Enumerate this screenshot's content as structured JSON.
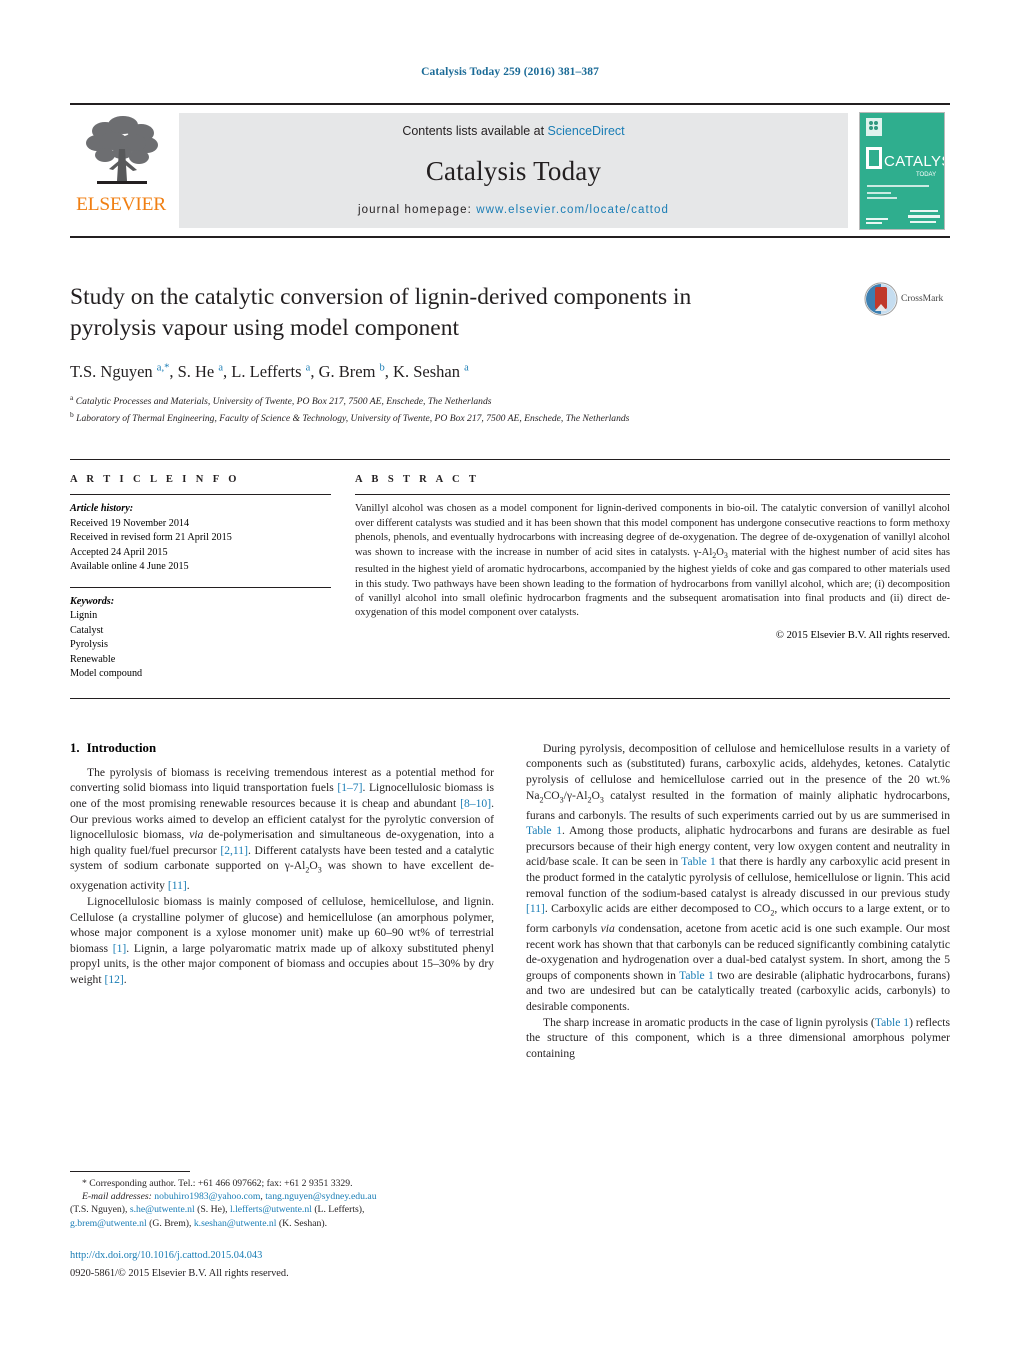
{
  "running_head": "Catalysis Today 259 (2016) 381–387",
  "masthead": {
    "contents_prefix": "Contents lists available at ",
    "sciencedirect": "ScienceDirect",
    "journal_title": "Catalysis Today",
    "homepage_prefix": "journal homepage: ",
    "homepage_url": "www.elsevier.com/locate/cattod",
    "publisher": "ELSEVIER",
    "cover_title": "CATALYSIS",
    "cover_sub": "TODAY"
  },
  "article": {
    "title": "Study on the catalytic conversion of lignin-derived components in pyrolysis vapour using model component",
    "crossmark_label": "CrossMark",
    "authors_html": "T.S. Nguyen <sup>a,*</sup>, S. He <sup>a</sup>, L. Lefferts <sup>a</sup>, G. Brem <sup>b</sup>, K. Seshan <sup>a</sup>",
    "affiliations": [
      {
        "marker": "a",
        "text": "Catalytic Processes and Materials, University of Twente, PO Box 217, 7500 AE, Enschede, The Netherlands"
      },
      {
        "marker": "b",
        "text": "Laboratory of Thermal Engineering, Faculty of Science & Technology, University of Twente, PO Box 217, 7500 AE, Enschede, The Netherlands"
      }
    ]
  },
  "article_info": {
    "heading": "A R T I C L E    I N F O",
    "history_label": "Article history:",
    "history": [
      "Received 19 November 2014",
      "Received in revised form 21 April 2015",
      "Accepted 24 April 2015",
      "Available online 4 June 2015"
    ],
    "keywords_label": "Keywords:",
    "keywords": [
      "Lignin",
      "Catalyst",
      "Pyrolysis",
      "Renewable",
      "Model compound"
    ]
  },
  "abstract": {
    "heading": "A B S T R A C T",
    "text": "Vanillyl alcohol was chosen as a model component for lignin-derived components in bio-oil. The catalytic conversion of vanillyl alcohol over different catalysts was studied and it has been shown that this model component has undergone consecutive reactions to form methoxy phenols, phenols, and eventually hydrocarbons with increasing degree of de-oxygenation. The degree of de-oxygenation of vanillyl alcohol was shown to increase with the increase in number of acid sites in catalysts. γ-Al2O3 material with the highest number of acid sites has resulted in the highest yield of aromatic hydrocarbons, accompanied by the highest yields of coke and gas compared to other materials used in this study. Two pathways have been shown leading to the formation of hydrocarbons from vanillyl alcohol, which are; (i) decomposition of vanillyl alcohol into small olefinic hydrocarbon fragments and the subsequent aromatisation into final products and (ii) direct de-oxygenation of this model component over catalysts.",
    "copyright": "© 2015 Elsevier B.V. All rights reserved."
  },
  "body": {
    "section_number": "1.",
    "section_title": "Introduction",
    "left_paragraphs": [
      "The pyrolysis of biomass is receiving tremendous interest as a potential method for converting solid biomass into liquid transportation fuels [1–7]. Lignocellulosic biomass is one of the most promising renewable resources because it is cheap and abundant [8–10]. Our previous works aimed to develop an efficient catalyst for the pyrolytic conversion of lignocellulosic biomass, via de-polymerisation and simultaneous de-oxygenation, into a high quality fuel/fuel precursor [2,11]. Different catalysts have been tested and a catalytic system of sodium carbonate supported on γ-Al2O3 was shown to have excellent de-oxygenation activity [11].",
      "Lignocellulosic biomass is mainly composed of cellulose, hemicellulose, and lignin. Cellulose (a crystalline polymer of glucose) and hemicellulose (an amorphous polymer, whose major component is a xylose monomer unit) make up 60–90 wt% of terrestrial biomass [1]. Lignin, a large polyaromatic matrix made up of alkoxy substituted phenyl propyl units, is the other major component of biomass and occupies about 15–30% by dry weight [12]."
    ],
    "right_paragraphs": [
      "During pyrolysis, decomposition of cellulose and hemicellulose results in a variety of components such as (substituted) furans, carboxylic acids, aldehydes, ketones. Catalytic pyrolysis of cellulose and hemicellulose carried out in the presence of the 20 wt.% Na2CO3/γ-Al2O3 catalyst resulted in the formation of mainly aliphatic hydrocarbons, furans and carbonyls. The results of such experiments carried out by us are summerised in Table 1. Among those products, aliphatic hydrocarbons and furans are desirable as fuel precursors because of their high energy content, very low oxygen content and neutrality in acid/base scale. It can be seen in Table 1 that there is hardly any carboxylic acid present in the product formed in the catalytic pyrolysis of cellulose, hemicellulose or lignin. This acid removal function of the sodium-based catalyst is already discussed in our previous study [11]. Carboxylic acids are either decomposed to CO2, which occurs to a large extent, or to form carbonyls via condensation, acetone from acetic acid is one such example. Our most recent work has shown that that carbonyls can be reduced significantly combining catalytic de-oxygenation and hydrogenation over a dual-bed catalyst system. In short, among the 5 groups of components shown in Table 1 two are desirable (aliphatic hydrocarbons, furans) and two are undesired but can be catalytically treated (carboxylic acids, carbonyls) to desirable components.",
      "The sharp increase in aromatic products in the case of lignin pyrolysis (Table 1) reflects the structure of this component, which is a three dimensional amorphous polymer containing"
    ]
  },
  "footnote": {
    "corresponding": "* Corresponding author. Tel.: +61 466 097662; fax: +61 2 9351 3329.",
    "email_label": "E-mail addresses:",
    "emails": [
      {
        "address": "nobuhiro1983@yahoo.com",
        "sep": ", "
      },
      {
        "address": "tang.nguyen@sydney.edu.au",
        "sep": ""
      }
    ],
    "email_line1": "nobuhiro1983@yahoo.com, tang.nguyen@sydney.edu.au",
    "email_line2_owner": "(T.S. Nguyen), ",
    "email2": "s.he@utwente.nl",
    "email2_owner": " (S. He), ",
    "email3": "l.lefferts@utwente.nl",
    "email3_owner": " (L. Lefferts),",
    "email4": "g.brem@utwente.nl",
    "email4_owner": " (G. Brem), ",
    "email5": "k.seshan@utwente.nl",
    "email5_owner": " (K. Seshan).",
    "doi": "http://dx.doi.org/10.1016/j.cattod.2015.04.043",
    "issn": "0920-5861/© 2015 Elsevier B.V. All rights reserved."
  },
  "colors": {
    "link": "#1a7db5",
    "running_head": "#1a6a96",
    "elsevier_orange": "#f07f13",
    "masthead_bg": "#e6e7e8",
    "cover_green": "#2fae8e"
  }
}
